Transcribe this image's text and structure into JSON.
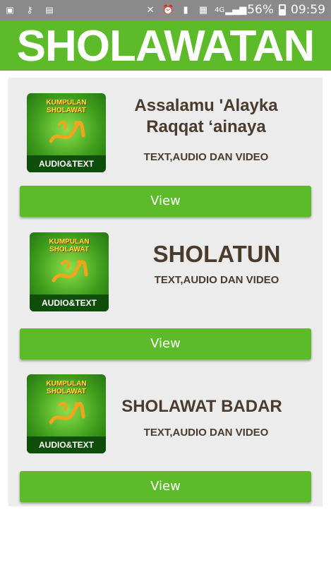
{
  "status_bar": {
    "battery_percent": "56%",
    "time": "09:59",
    "network": "4G",
    "icons": [
      "message-icon",
      "key-icon",
      "clipboard-icon",
      "mute-icon",
      "alarm-icon",
      "sim-icon",
      "image-icon",
      "signal-icon",
      "battery-icon"
    ]
  },
  "header": {
    "title": "SHOLAWATAN",
    "color": "#5dbb2a"
  },
  "thumbnail": {
    "top_text": "KUMPULAN SHOLAWAT",
    "bottom_text": "AUDIO&TEXT"
  },
  "items": [
    {
      "title_line1": "Assalamu 'Alayka",
      "title_line2": "Raqqat ‘ainaya",
      "subtitle": "TEXT,AUDIO DAN VIDEO",
      "button_label": "View"
    },
    {
      "title_line1": "SHOLATUN",
      "subtitle": "TEXT,AUDIO DAN VIDEO",
      "button_label": "View"
    },
    {
      "title_line1": "SHOLAWAT BADAR",
      "subtitle": "TEXT,AUDIO DAN VIDEO",
      "button_label": "View"
    }
  ]
}
